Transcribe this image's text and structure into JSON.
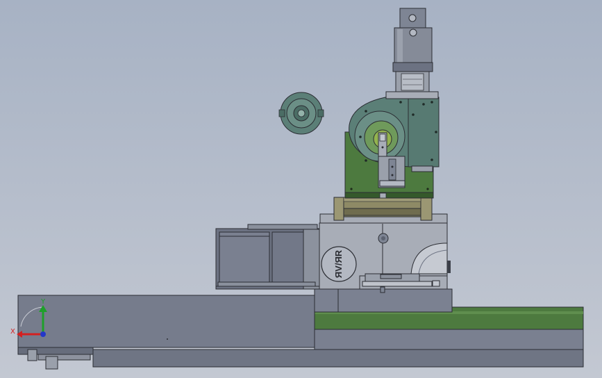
{
  "viewport": {
    "background_top": "#a7b2c4",
    "background_bottom": "#c3c8d2"
  },
  "model": {
    "colors": {
      "steel": "#7e8594",
      "steel_dark": "#5c6270",
      "steel_light": "#b3b8c2",
      "green_plate": "#4d7a3f",
      "green_dark": "#35592b",
      "teal_part": "#5b7f77",
      "olive_block": "#8e8a66",
      "outline": "#2b2d33"
    },
    "part_icons": [
      "coupling-icon",
      "cylinder-icon",
      "motor-icon",
      "housing-icon",
      "gearbox-icon",
      "base-plate-icon"
    ],
    "housing_logo": "ЯV/ЯR"
  },
  "triad": {
    "x_label": "X",
    "y_label": "Y",
    "x_color": "#d42020",
    "y_color": "#1ea02a",
    "z_color": "#2438c8"
  }
}
